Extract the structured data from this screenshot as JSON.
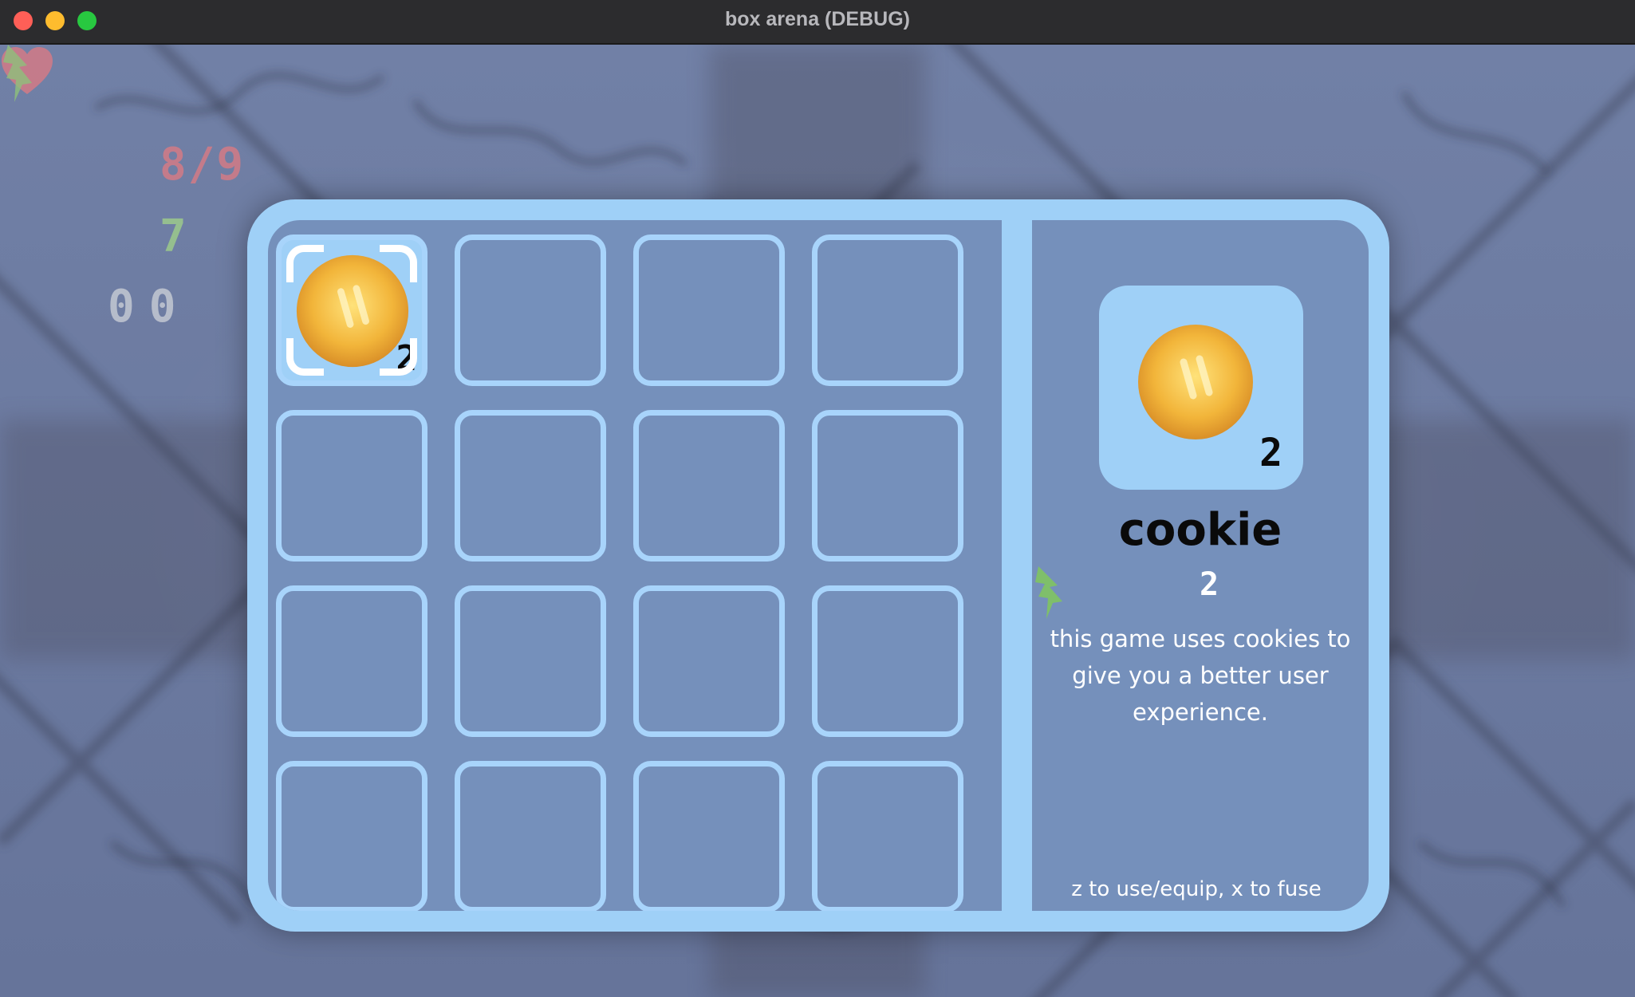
{
  "window": {
    "title": "box arena (DEBUG)"
  },
  "hud": {
    "health": "8/9",
    "energy": "7",
    "coordinates": "00",
    "heart_icon": "heart-icon",
    "bolt_icon": "lightning-bolt-icon"
  },
  "inventory": {
    "slots": [
      {
        "item": "cookie",
        "quantity": "2",
        "selected": true
      },
      {
        "item": null
      },
      {
        "item": null
      },
      {
        "item": null
      },
      {
        "item": null
      },
      {
        "item": null
      },
      {
        "item": null
      },
      {
        "item": null
      },
      {
        "item": null
      },
      {
        "item": null
      },
      {
        "item": null
      },
      {
        "item": null
      },
      {
        "item": null
      },
      {
        "item": null
      },
      {
        "item": null
      },
      {
        "item": null
      }
    ]
  },
  "detail": {
    "name": "cookie",
    "quantity": "2",
    "energy_cost": "2",
    "description": "this game uses cookies to give you a better user experience.",
    "hint": "z to use/equip, x to fuse"
  },
  "colors": {
    "panel_border": "#9fd0f7",
    "panel_fill": "#7590bb",
    "slot_border": "#a8d4fb",
    "health": "#e07a82",
    "energy": "#9fcf8a"
  }
}
